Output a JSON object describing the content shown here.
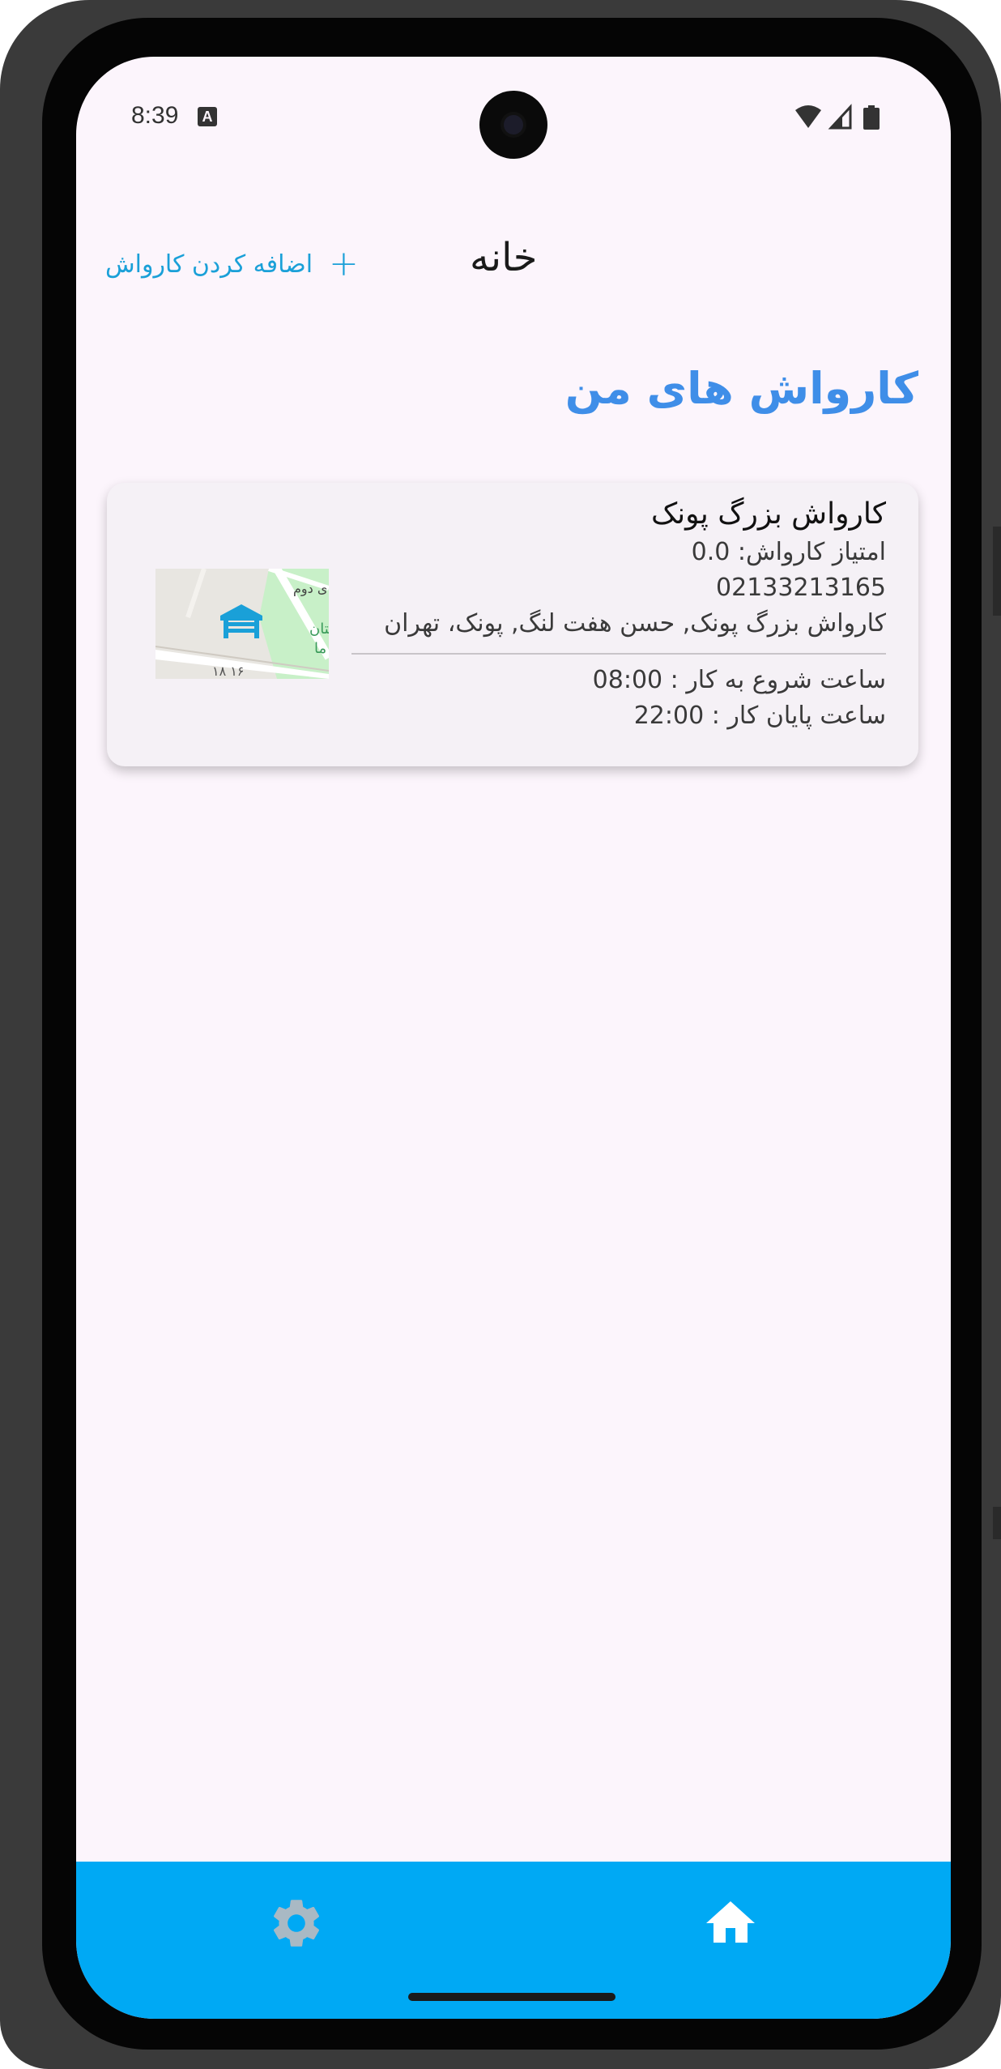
{
  "status_bar": {
    "time": "8:39",
    "notification_letter": "A"
  },
  "app_bar": {
    "title": "خانه",
    "add_label": "اضافه کردن کارواش",
    "add_icon": "plus-icon"
  },
  "section": {
    "title": "کارواش های من"
  },
  "carwashes": [
    {
      "name": "کارواش بزرگ پونک",
      "rating_label": "امتیاز کارواش: 0.0",
      "phone": "02133213165",
      "address": "کارواش بزرگ پونک, حسن هفت لنگ, پونک، تهران",
      "start_time": "ساعت شروع به کار : 08:00",
      "end_time": "ساعت پایان کار : 22:00",
      "map": {
        "label_1": "ی دوم",
        "label_2": "ستان",
        "label_3": "ما",
        "label_4": "۱۸ ۱۶",
        "marker_icon": "carwash-marker-icon"
      }
    }
  ],
  "bottom_nav": {
    "items": [
      {
        "icon": "gear-icon",
        "active": false
      },
      {
        "icon": "home-icon",
        "active": true
      }
    ],
    "background": "#00a9f4"
  },
  "colors": {
    "accent": "#3f8ee8",
    "link": "#1aa0d8",
    "screen_bg": "#fcf5fc",
    "card_bg": "#f5f1f6"
  }
}
